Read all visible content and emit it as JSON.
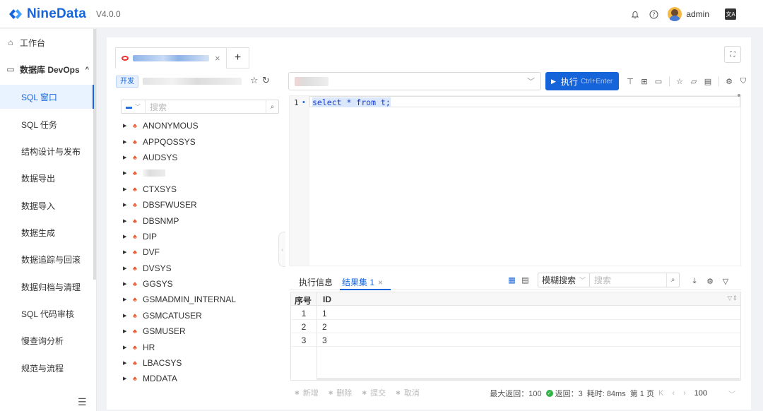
{
  "app": {
    "name": "NineData",
    "version": "V4.0.0",
    "user": "admin"
  },
  "colors": {
    "brand": "#1664d9",
    "active_bg": "#e9f2ff",
    "success": "#2fb344",
    "schema_icon": "#e8582c"
  },
  "sidebar": {
    "workbench": "工作台",
    "group": "数据库 DevOps",
    "items": [
      "SQL 窗口",
      "SQL 任务",
      "结构设计与发布",
      "数据导出",
      "数据导入",
      "数据生成",
      "数据追踪与回滚",
      "数据归档与清理",
      "SQL 代码审核",
      "慢查询分析",
      "规范与流程"
    ],
    "active_index": 0
  },
  "query_tab": {
    "close": "×",
    "add": "+"
  },
  "connection": {
    "env_tag": "开发"
  },
  "toolbar": {
    "execute_label": "执行",
    "execute_shortcut": "Ctrl+Enter"
  },
  "tree": {
    "search_placeholder": "搜索",
    "schemas": [
      "ANONYMOUS",
      "APPQOSSYS",
      "AUDSYS",
      "",
      "CTXSYS",
      "DBSFWUSER",
      "DBSNMP",
      "DIP",
      "DVF",
      "DVSYS",
      "GGSYS",
      "GSMADMIN_INTERNAL",
      "GSMCATUSER",
      "GSMUSER",
      "HR",
      "LBACSYS",
      "MDDATA"
    ]
  },
  "editor": {
    "line_number": "1",
    "code": "select * from t;"
  },
  "results": {
    "tab_info": "执行信息",
    "tab_result": "结果集 1",
    "fuzzy_search": "模糊搜索",
    "search_placeholder": "搜索",
    "columns": [
      "序号",
      "ID"
    ],
    "rows": [
      {
        "idx": "1",
        "id": "1"
      },
      {
        "idx": "2",
        "id": "2"
      },
      {
        "idx": "3",
        "id": "3"
      }
    ],
    "actions": {
      "add": "新增",
      "delete": "删除",
      "commit": "提交",
      "cancel": "取消"
    },
    "footer": {
      "max_return": "最大返回：100",
      "returned": "返回：3",
      "elapsed": "耗时: 84ms",
      "page": "第 1 页",
      "page_size": "100"
    }
  }
}
